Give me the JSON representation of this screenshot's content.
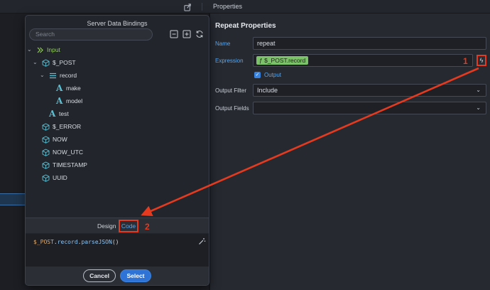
{
  "topbar": {
    "panel_title": "Properties"
  },
  "properties": {
    "section_title": "Repeat Properties",
    "name_label": "Name",
    "name_value": "repeat",
    "expression_label": "Expression",
    "expression_value": "ƒ $_POST.record",
    "output_checkbox_label": "Output",
    "output_checked": true,
    "output_filter_label": "Output Filter",
    "output_filter_value": "Include",
    "output_fields_label": "Output Fields",
    "output_fields_value": ""
  },
  "annotations": {
    "badge_1": "1",
    "badge_2": "2",
    "color": "#e43a1f"
  },
  "dialog": {
    "title": "Server Data Bindings",
    "search_placeholder": "Search",
    "tree": [
      {
        "label": "Input",
        "icon": "chevrons-right-icon"
      },
      {
        "label": "$_POST",
        "icon": "cube-icon"
      },
      {
        "label": "record",
        "icon": "list-icon"
      },
      {
        "label": "make",
        "icon": "text-A-icon"
      },
      {
        "label": "model",
        "icon": "text-A-icon"
      },
      {
        "label": "test",
        "icon": "text-A-icon"
      },
      {
        "label": "$_ERROR",
        "icon": "cube-icon"
      },
      {
        "label": "NOW",
        "icon": "cube-icon"
      },
      {
        "label": "NOW_UTC",
        "icon": "cube-icon"
      },
      {
        "label": "TIMESTAMP",
        "icon": "cube-icon"
      },
      {
        "label": "UUID",
        "icon": "cube-icon"
      }
    ],
    "tabs": {
      "design": "Design",
      "code": "Code"
    },
    "code": {
      "var": "$_POST",
      "dot1": ".",
      "prop": "record",
      "dot2": ".",
      "fn": "parseJSON",
      "tail": "()"
    },
    "cancel_label": "Cancel",
    "select_label": "Select"
  }
}
